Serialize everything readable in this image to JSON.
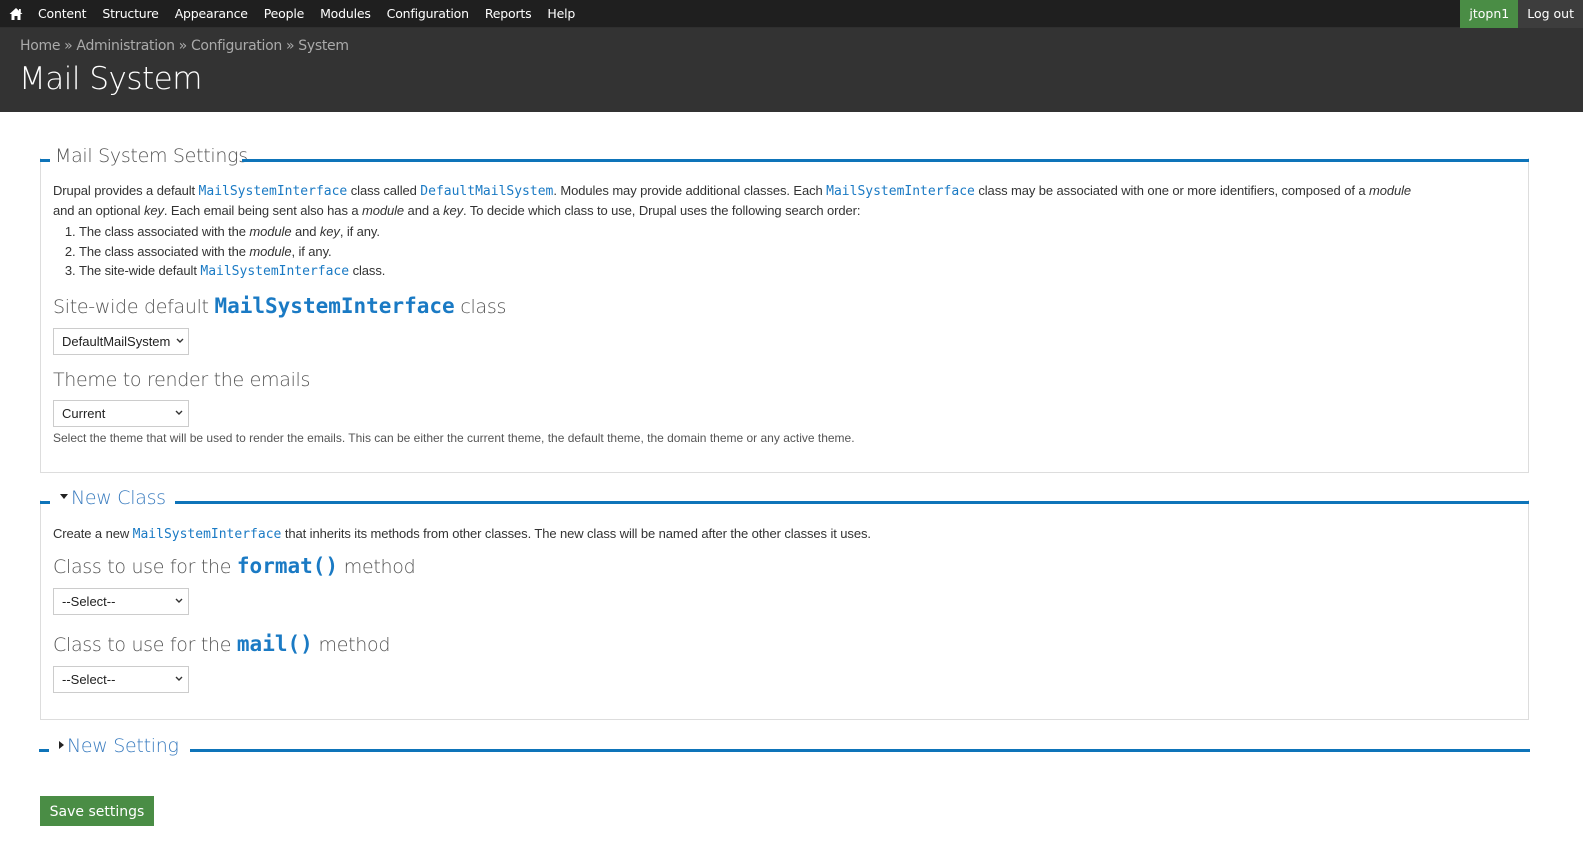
{
  "toolbar": {
    "home_icon": "home-icon",
    "menu": [
      "Content",
      "Structure",
      "Appearance",
      "People",
      "Modules",
      "Configuration",
      "Reports",
      "Help"
    ],
    "user": "jtopn1",
    "logout": "Log out",
    "colors": {
      "background": "#1f1f1f",
      "user_bg": "#4a8d45",
      "logout_bg": "#3d3d3d"
    }
  },
  "header": {
    "breadcrumb": [
      "Home",
      "Administration",
      "Configuration",
      "System"
    ],
    "breadcrumb_separator": "»",
    "title": "Mail System"
  },
  "mail_system_settings": {
    "legend": "Mail System Settings",
    "description": {
      "p1_a": "Drupal provides a default ",
      "p1_code1": "MailSystemInterface",
      "p1_b": " class called ",
      "p1_code2": "DefaultMailSystem",
      "p1_c": ". Modules may provide additional classes. Each ",
      "p1_code3": "MailSystemInterface",
      "p1_d": " class may be associated with one or more identifiers, composed of a ",
      "p1_em1": "module",
      "p2_a": "and an optional ",
      "p2_em1": "key",
      "p2_b": ". Each email being sent also has a ",
      "p2_em2": "module",
      "p2_c": " and a ",
      "p2_em3": "key",
      "p2_d": ". To decide which class to use, Drupal uses the following search order:"
    },
    "search_order": [
      {
        "a": "The class associated with the ",
        "em1": "module",
        "b": " and ",
        "em2": "key",
        "c": ", if any."
      },
      {
        "a": "The class associated with the ",
        "em1": "module",
        "b": ", if any."
      },
      {
        "a": "The site-wide default ",
        "code": "MailSystemInterface",
        "b": " class."
      }
    ],
    "site_default": {
      "label_a": "Site-wide default ",
      "label_code": "MailSystemInterface",
      "label_b": " class",
      "selected": "DefaultMailSystem"
    },
    "theme": {
      "label": "Theme to render the emails",
      "selected": "Current",
      "help": "Select the theme that will be used to render the emails. This can be either the current theme, the default theme, the domain theme or any active theme."
    }
  },
  "new_class": {
    "legend": "New Class",
    "expanded": true,
    "description": {
      "a": "Create a new ",
      "code": "MailSystemInterface",
      "b": " that inherits its methods from other classes. The new class will be named after the other classes it uses."
    },
    "format": {
      "label_a": "Class to use for the ",
      "label_code": "format()",
      "label_b": " method",
      "selected": "--Select--"
    },
    "mail": {
      "label_a": "Class to use for the ",
      "label_code": "mail()",
      "label_b": " method",
      "selected": "--Select--"
    }
  },
  "new_setting": {
    "legend": "New Setting",
    "expanded": false
  },
  "actions": {
    "save": "Save settings"
  },
  "colors": {
    "accent_blue": "#0e74b9",
    "code_blue": "#1a7ac4",
    "button_green": "#4a8d45",
    "header_bg": "#333333"
  }
}
